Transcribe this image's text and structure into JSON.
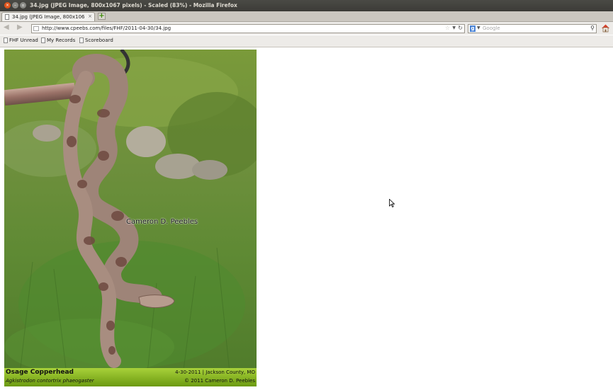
{
  "window": {
    "title": "34.jpg (JPEG Image, 800x1067 pixels) - Scaled (83%) - Mozilla Firefox"
  },
  "tabs": [
    {
      "label": "34.jpg (JPEG Image, 800x1067 pix..."
    }
  ],
  "navigation": {
    "url": "http://www.cpeebs.com/files/FHF/2011-04-30/34.jpg",
    "search_placeholder": "Google"
  },
  "bookmarks": [
    {
      "label": "FHF Unread"
    },
    {
      "label": "My Records"
    },
    {
      "label": "Scoreboard"
    }
  ],
  "image": {
    "watermark": "Cameron D. Peebles",
    "caption": {
      "common_name": "Osage Copperhead",
      "scientific_name": "Agkistrodon contortrix phaeogaster",
      "date_location": "4-30-2011 | Jackson County, MO",
      "copyright": "© 2011 Cameron D. Peebles"
    }
  },
  "icons": {
    "back": "back-arrow-icon",
    "forward": "forward-arrow-icon",
    "reload": "reload-icon",
    "home": "home-icon",
    "search": "magnifier-icon",
    "bookmark_star": "star-icon"
  }
}
